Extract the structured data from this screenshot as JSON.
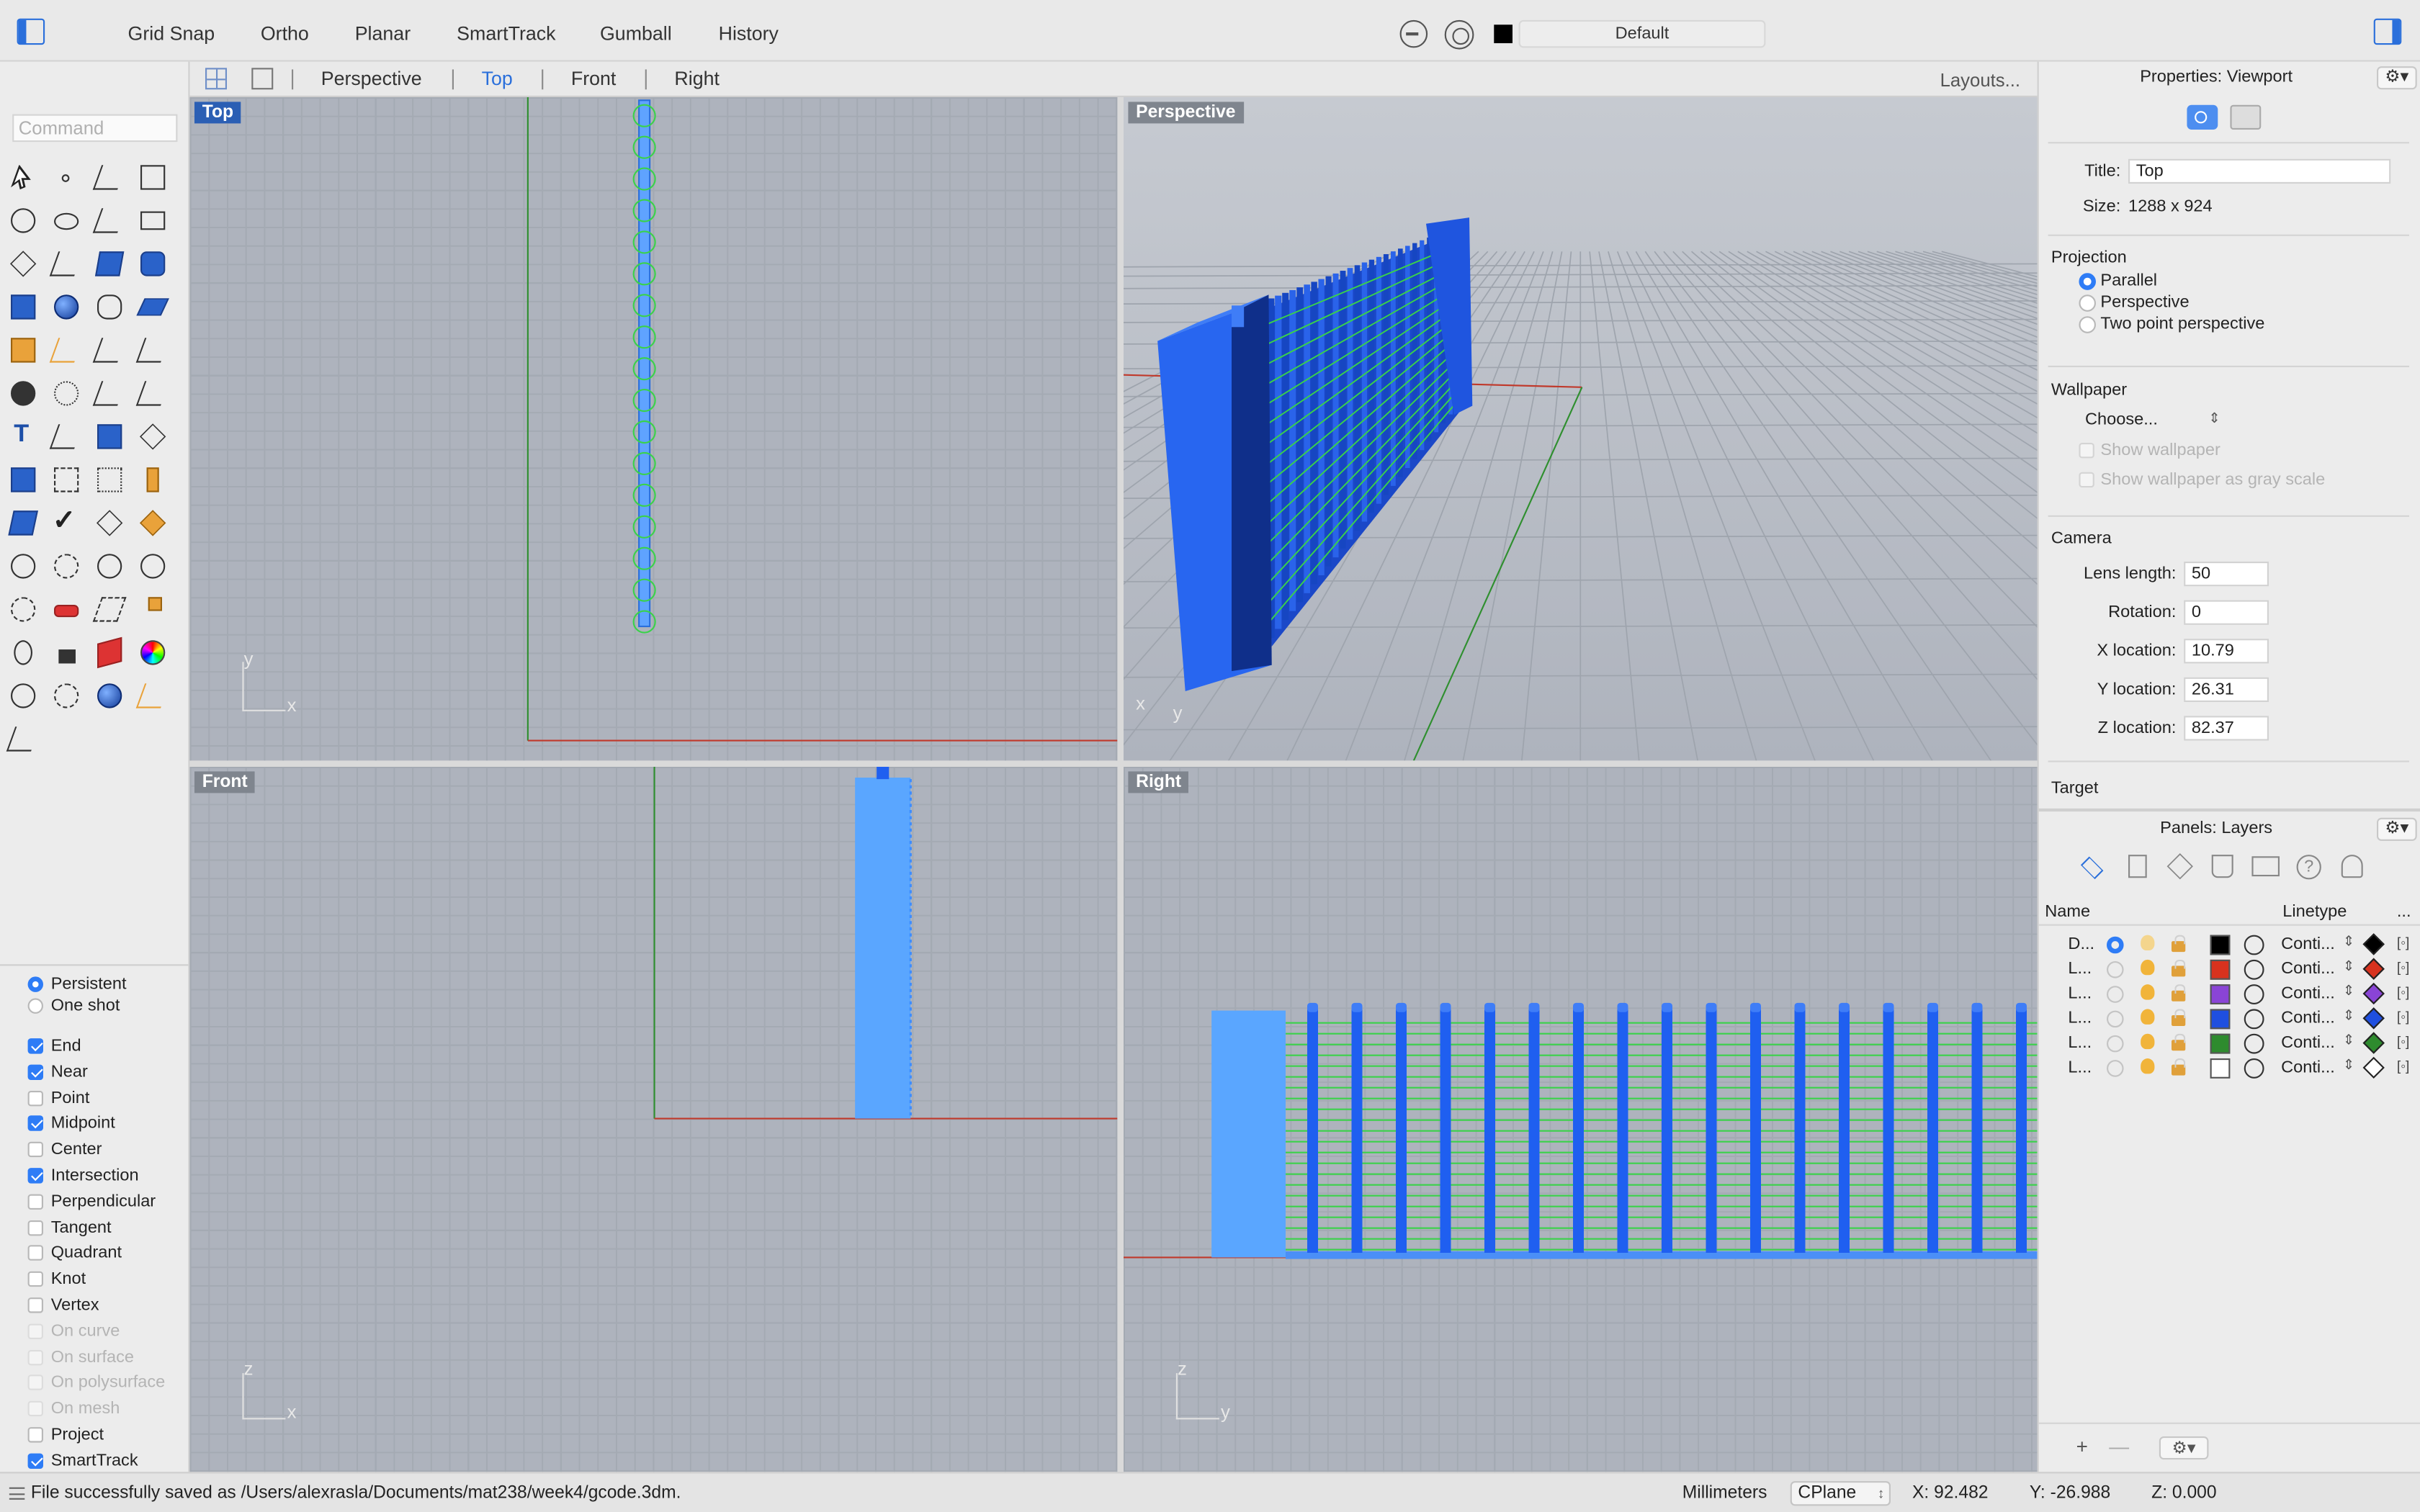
{
  "toolbar": {
    "modes": [
      {
        "label": "Grid Snap",
        "on": true
      },
      {
        "label": "Ortho",
        "on": false
      },
      {
        "label": "Planar",
        "on": false
      },
      {
        "label": "SmartTrack",
        "on": true
      },
      {
        "label": "Gumball",
        "on": false
      },
      {
        "label": "History",
        "on": false
      }
    ],
    "current_layer": "Default"
  },
  "command": {
    "placeholder": "Command"
  },
  "viewport_tabs": {
    "tabs": [
      "Perspective",
      "Top",
      "Front",
      "Right"
    ],
    "active": "Top",
    "layouts_label": "Layouts..."
  },
  "viewports": {
    "top": {
      "label": "Top",
      "axis_h": "x",
      "axis_v": "y"
    },
    "perspective": {
      "label": "Perspective",
      "axis_h": "x",
      "axis_v": "y"
    },
    "front": {
      "label": "Front",
      "axis_h": "x",
      "axis_v": "z"
    },
    "right": {
      "label": "Right",
      "axis_h": "y",
      "axis_v": "z"
    }
  },
  "snaps": {
    "mode_options": [
      {
        "label": "Persistent",
        "selected": true
      },
      {
        "label": "One shot",
        "selected": false
      }
    ],
    "items": [
      {
        "label": "End",
        "checked": true,
        "enabled": true
      },
      {
        "label": "Near",
        "checked": true,
        "enabled": true
      },
      {
        "label": "Point",
        "checked": false,
        "enabled": true
      },
      {
        "label": "Midpoint",
        "checked": true,
        "enabled": true
      },
      {
        "label": "Center",
        "checked": false,
        "enabled": true
      },
      {
        "label": "Intersection",
        "checked": true,
        "enabled": true
      },
      {
        "label": "Perpendicular",
        "checked": false,
        "enabled": true
      },
      {
        "label": "Tangent",
        "checked": false,
        "enabled": true
      },
      {
        "label": "Quadrant",
        "checked": false,
        "enabled": true
      },
      {
        "label": "Knot",
        "checked": false,
        "enabled": true
      },
      {
        "label": "Vertex",
        "checked": false,
        "enabled": true
      },
      {
        "label": "On curve",
        "checked": false,
        "enabled": false
      },
      {
        "label": "On surface",
        "checked": false,
        "enabled": false
      },
      {
        "label": "On polysurface",
        "checked": false,
        "enabled": false
      },
      {
        "label": "On mesh",
        "checked": false,
        "enabled": false
      },
      {
        "label": "Project",
        "checked": false,
        "enabled": true
      },
      {
        "label": "SmartTrack",
        "checked": true,
        "enabled": true
      }
    ]
  },
  "properties": {
    "header": "Properties: Viewport",
    "title_label": "Title:",
    "title_value": "Top",
    "size_label": "Size:",
    "size_value": "1288 x 924",
    "projection": {
      "label": "Projection",
      "options": [
        {
          "label": "Parallel",
          "selected": true
        },
        {
          "label": "Perspective",
          "selected": false
        },
        {
          "label": "Two point perspective",
          "selected": false
        }
      ]
    },
    "wallpaper": {
      "label": "Wallpaper",
      "choose_label": "Choose...",
      "show_label": "Show wallpaper",
      "gray_label": "Show wallpaper as gray scale"
    },
    "camera": {
      "label": "Camera",
      "fields": [
        {
          "label": "Lens length:",
          "value": "50"
        },
        {
          "label": "Rotation:",
          "value": "0"
        },
        {
          "label": "X location:",
          "value": "10.79"
        },
        {
          "label": "Y location:",
          "value": "26.31"
        },
        {
          "label": "Z location:",
          "value": "82.37"
        }
      ]
    },
    "target_label": "Target"
  },
  "layers_panel": {
    "header": "Panels: Layers",
    "columns": {
      "name": "Name",
      "linetype": "Linetype",
      "more": "..."
    },
    "rows": [
      {
        "name": "D...",
        "current": true,
        "color": "#000000",
        "print_color": "#000000",
        "linetype": "Conti..."
      },
      {
        "name": "L...",
        "current": false,
        "color": "#d8321e",
        "print_color": "#d8321e",
        "linetype": "Conti..."
      },
      {
        "name": "L...",
        "current": false,
        "color": "#8a44d6",
        "print_color": "#8a44d6",
        "linetype": "Conti..."
      },
      {
        "name": "L...",
        "current": false,
        "color": "#1f4fe0",
        "print_color": "#1f4fe0",
        "linetype": "Conti..."
      },
      {
        "name": "L...",
        "current": false,
        "color": "#2e8b2e",
        "print_color": "#2e8b2e",
        "linetype": "Conti..."
      },
      {
        "name": "L...",
        "current": false,
        "color": "#ffffff",
        "print_color": "#ffffff",
        "linetype": "Conti..."
      }
    ]
  },
  "status": {
    "message": "File successfully saved as /Users/alexrasla/Documents/mat238/week4/gcode.3dm.",
    "units": "Millimeters",
    "cplane": "CPlane",
    "x": "X: 92.482",
    "y": "Y: -26.988",
    "z": "Z: 0.000"
  },
  "colors": {
    "accent": "#2e7cf6",
    "object_blue": "#1f5ff0",
    "toolpath_green": "#3ad24a",
    "viewport_bg": "#aeb3bd",
    "x_axis": "#c0392b",
    "y_axis": "#2f8f2f"
  }
}
